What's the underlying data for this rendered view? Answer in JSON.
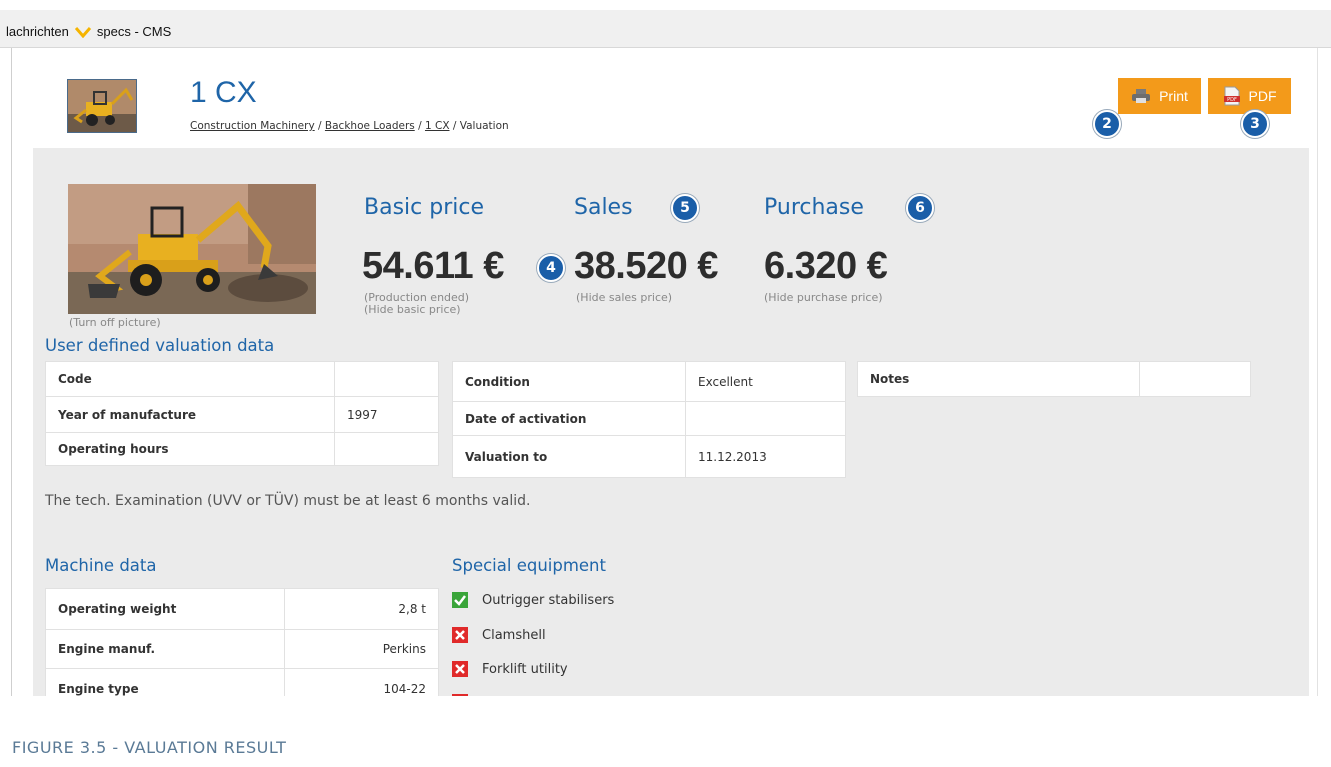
{
  "browser": {
    "tab_text_1": "lachrichten",
    "tab_text_2": "specs - CMS"
  },
  "header": {
    "title": "1 CX",
    "breadcrumb": [
      {
        "label": "Construction Machinery",
        "link": true
      },
      {
        "label": "Backhoe Loaders",
        "link": true
      },
      {
        "label": "1 CX",
        "link": true
      },
      {
        "label": "Valuation",
        "link": false
      }
    ],
    "print_label": "Print",
    "pdf_label": "PDF"
  },
  "badges": {
    "b2": "2",
    "b3": "3",
    "b4": "4",
    "b5": "5",
    "b6": "6"
  },
  "hero": {
    "caption": "(Turn off picture)"
  },
  "prices": {
    "basic": {
      "heading": "Basic price",
      "value": "54.611 €",
      "sub1": "(Production ended)",
      "sub2": "(Hide basic price)"
    },
    "sales": {
      "heading": "Sales",
      "value": "38.520 €",
      "sub1": "(Hide sales price)"
    },
    "purchase": {
      "heading": "Purchase",
      "value": "6.320 €",
      "sub1": "(Hide purchase price)"
    }
  },
  "user_data": {
    "title": "User defined valuation data",
    "left": [
      {
        "label": "Code",
        "value": ""
      },
      {
        "label": "Year of manufacture",
        "value": "1997"
      },
      {
        "label": "Operating hours",
        "value": ""
      }
    ],
    "middle": [
      {
        "label": "Condition",
        "value": "Excellent"
      },
      {
        "label": "Date of activation",
        "value": ""
      },
      {
        "label": "Valuation to",
        "value": "11.12.2013"
      }
    ],
    "notes_label": "Notes"
  },
  "note": "The tech. Examination (UVV or TÜV) must be at least 6 months valid.",
  "machine_data": {
    "title": "Machine data",
    "rows": [
      {
        "label": "Operating weight",
        "value": "2,8 t"
      },
      {
        "label": "Engine manuf.",
        "value": "Perkins"
      },
      {
        "label": "Engine type",
        "value": "104-22"
      }
    ]
  },
  "special_equipment": {
    "title": "Special equipment",
    "items": [
      {
        "label": "Outrigger stabilisers",
        "checked": true
      },
      {
        "label": "Clamshell",
        "checked": false
      },
      {
        "label": "Forklift utility",
        "checked": false
      }
    ]
  },
  "colors": {
    "accent": "#1f65a8",
    "button": "#f39a1a",
    "check_on": "#3aa53a",
    "check_off": "#e02a2a"
  },
  "figure_caption": "FIGURE 3.5 - VALUATION RESULT"
}
